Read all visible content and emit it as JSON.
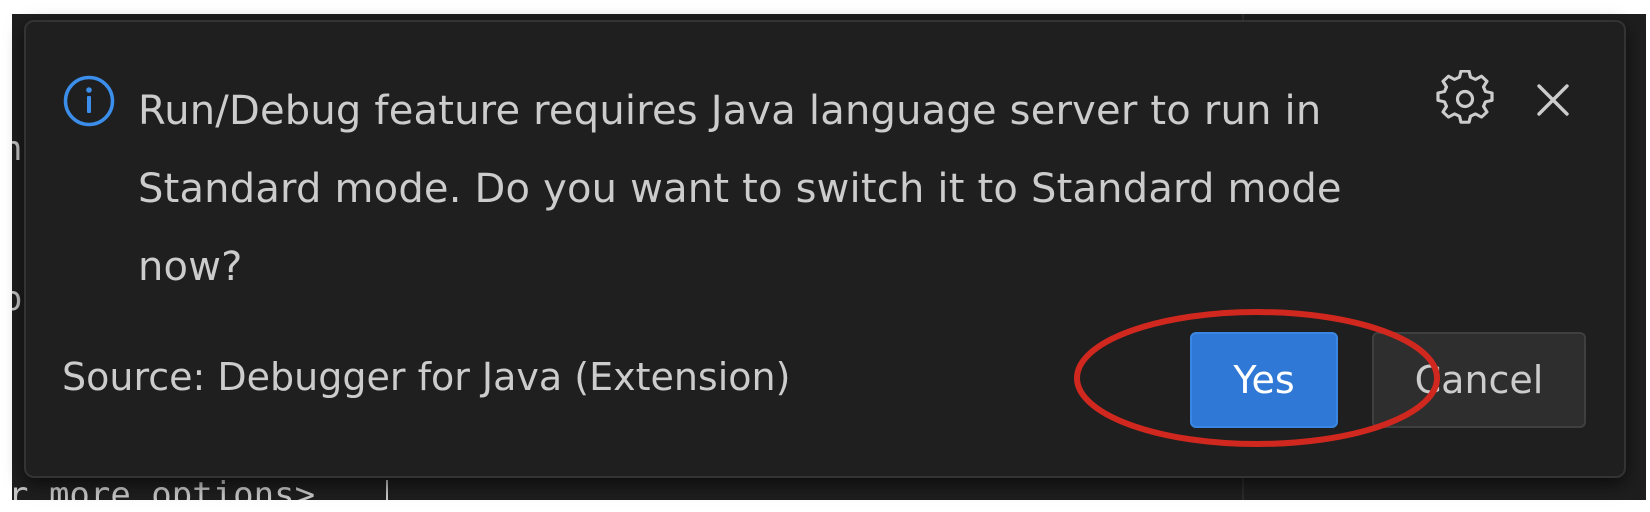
{
  "editor": {
    "code_fragment_a": "n",
    "code_fragment_b": "o",
    "code_fragment_c": "r more options>"
  },
  "notification": {
    "message": "Run/Debug feature requires Java language server to run in Standard mode. Do you want to switch it to Standard mode now?",
    "source": "Source: Debugger for Java (Extension)",
    "icons": {
      "info": "info-icon",
      "settings": "gear-icon",
      "close": "close-icon"
    },
    "buttons": {
      "primary_label": "Yes",
      "secondary_label": "Cancel"
    }
  },
  "annotation": {
    "type": "red-ellipse-highlight",
    "target": "Yes",
    "color": "#d0281e"
  },
  "colors": {
    "toast_background": "#1f1f1f",
    "text": "#cccccc",
    "primary_button": "#2f78d5",
    "secondary_button": "#2e2e2e",
    "info_icon": "#3b8eea"
  }
}
